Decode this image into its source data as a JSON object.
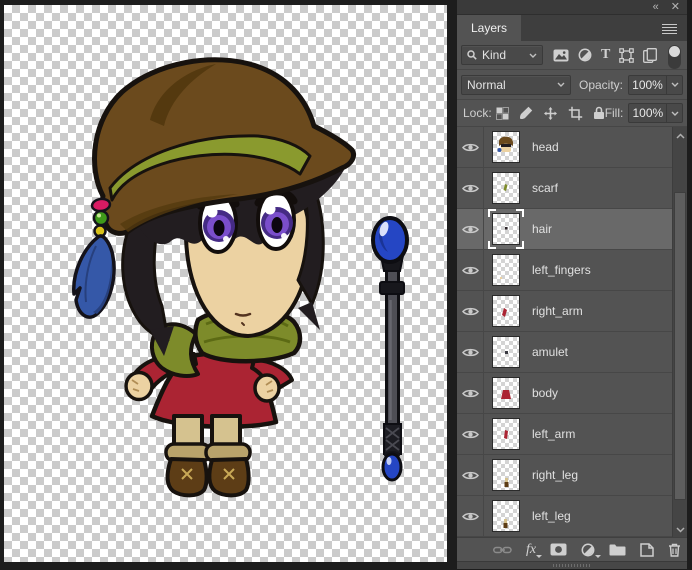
{
  "window": {
    "collapse_icon": "«",
    "close_icon": "✕"
  },
  "layers_panel": {
    "tab_label": "Layers",
    "filter_bar": {
      "kind_label": "Kind",
      "type_filter_glyph": "T"
    },
    "blend_bar": {
      "mode_value": "Normal",
      "opacity_label": "Opacity:",
      "opacity_value": "100%"
    },
    "lock_bar": {
      "lock_label": "Lock:",
      "fill_label": "Fill:",
      "fill_value": "100%"
    },
    "layers": [
      {
        "name": "head",
        "visible": true,
        "selected": false
      },
      {
        "name": "scarf",
        "visible": true,
        "selected": false
      },
      {
        "name": "hair",
        "visible": true,
        "selected": true
      },
      {
        "name": "left_fingers",
        "visible": true,
        "selected": false
      },
      {
        "name": "right_arm",
        "visible": true,
        "selected": false
      },
      {
        "name": "amulet",
        "visible": true,
        "selected": false
      },
      {
        "name": "body",
        "visible": true,
        "selected": false
      },
      {
        "name": "left_arm",
        "visible": true,
        "selected": false
      },
      {
        "name": "right_leg",
        "visible": true,
        "selected": false
      },
      {
        "name": "left_leg",
        "visible": true,
        "selected": false
      }
    ],
    "footer": {
      "fx_label": "fx"
    }
  },
  "canvas": {
    "artwork_palette": {
      "outline": "#17120e",
      "hat": "#6b4a1d",
      "hatshadow": "#54390f",
      "hatband": "#8a9a2e",
      "hair": "#221d20",
      "skin": "#ecd2a2",
      "eye": "#7a4ecb",
      "eyedark": "#452b85",
      "scarf": "#7d8b2a",
      "scarfdark": "#5c6a14",
      "dress": "#ab2433",
      "boot": "#5d3d16",
      "bootcuff": "#b9a36b",
      "legwarm": "#d5c28f",
      "feather": "#3558a8",
      "featherdark": "#27407e",
      "staffwood": "#4e4e55",
      "orb": "#2546c4",
      "amulettop": "#5f5f6a",
      "amuletleft": "#2e2e36",
      "amuletright": "#4a4a54",
      "beadpink": "#d81b63",
      "beadgreen": "#3f9a1a",
      "beadyellow": "#d8c11a"
    }
  }
}
